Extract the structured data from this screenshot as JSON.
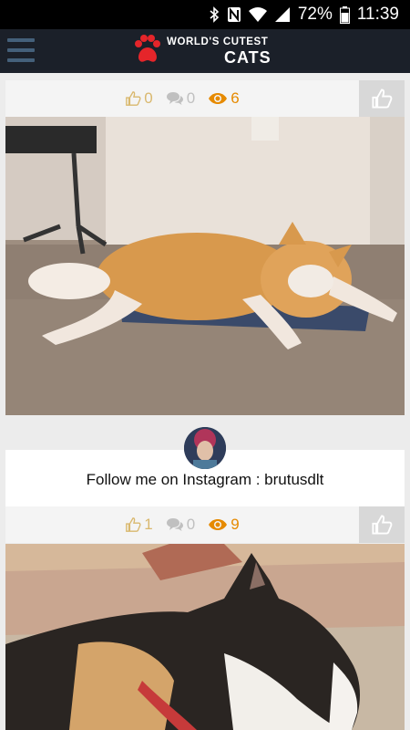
{
  "status_bar": {
    "battery": "72%",
    "time": "11:39",
    "icons": [
      "bluetooth-icon",
      "nfc-icon",
      "wifi-icon",
      "signal-icon",
      "battery-icon"
    ]
  },
  "app_bar": {
    "logo_line1": "WORLD'S CUTEST",
    "logo_line2": "CATS",
    "accent_color": "#e5252a"
  },
  "posts": [
    {
      "likes": "0",
      "comments": "0",
      "views": "6",
      "image": "orange and white cat lying on a rug on the carpet"
    },
    {
      "likes": "1",
      "comments": "0",
      "views": "9",
      "image": "calico cat in profile wearing a collar"
    }
  ],
  "caption": {
    "text": "Follow me on Instagram : brutusdlt"
  },
  "colors": {
    "like": "#d9b86e",
    "comment": "#c0c0c0",
    "views": "#e68a00",
    "app_bar": "#1b2029"
  }
}
